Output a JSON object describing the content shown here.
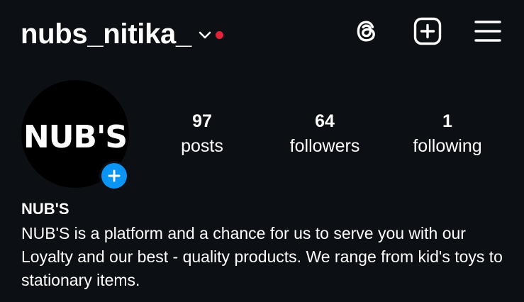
{
  "header": {
    "username": "nubs_nitika_",
    "notification_color": "#e0243a",
    "icons": [
      "chevron-down-icon",
      "threads-icon",
      "plus-square-icon",
      "hamburger-menu-icon"
    ]
  },
  "profile": {
    "avatar_logo_text": "NUB'S",
    "add_story_color": "#0a95f5"
  },
  "stats": {
    "posts": {
      "value": "97",
      "label": "posts"
    },
    "followers": {
      "value": "64",
      "label": "followers"
    },
    "following": {
      "value": "1",
      "label": "following"
    }
  },
  "bio": {
    "name": "NUB'S",
    "text": "NUB'S is a platform and a chance for us to serve you with our Loyalty and our best - quality products. We range from kid's toys to stationary items."
  }
}
